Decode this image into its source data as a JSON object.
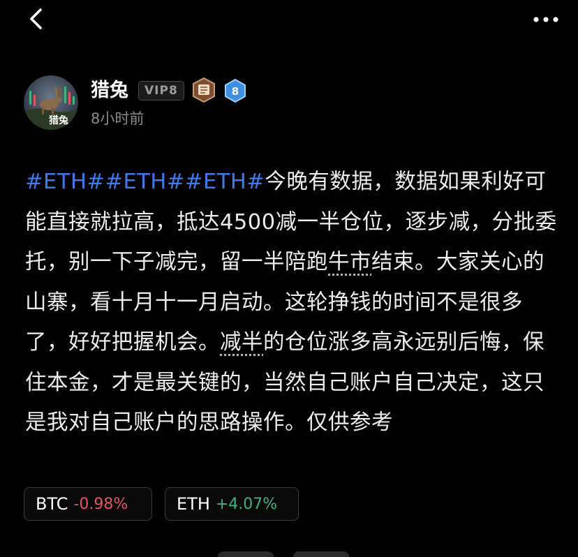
{
  "colors": {
    "background": "#000000",
    "hashtag": "#3a7bf0",
    "negative": "#e05563",
    "positive": "#3fb27f",
    "muted": "#8a8a8a"
  },
  "topbar": {
    "back_icon": "chevron-left-icon",
    "more_icon": "more-horizontal-icon"
  },
  "author": {
    "name": "猎兔",
    "vip": "VIP8",
    "level": "8",
    "medal_icon": "scroll-medal-icon",
    "avatar_caption": "猎兔",
    "time": "8小时前"
  },
  "post": {
    "hashtags": [
      "#ETH#",
      "#ETH#",
      "#ETH#"
    ],
    "text1": "今晚有数据，数据如果利好可能直接就拉高，抵达4500减一半仓位，逐步减，分批委托，别一下子减完，留一半陪跑",
    "link1": "牛市",
    "text2": "结束。大家关心的山寨，看十月十一月启动。这轮挣钱的时间不是很多了，好好把握机会。",
    "link2": "减半",
    "text3": "的仓位涨多高永远别后悔，保住本金，才是最关键的，当然自己账户自己决定，这只是我对自己账户的思路操作。仅供参考"
  },
  "tickers": [
    {
      "symbol": "BTC",
      "change": "-0.98%",
      "direction": "down"
    },
    {
      "symbol": "ETH",
      "change": "+4.07%",
      "direction": "up"
    }
  ]
}
